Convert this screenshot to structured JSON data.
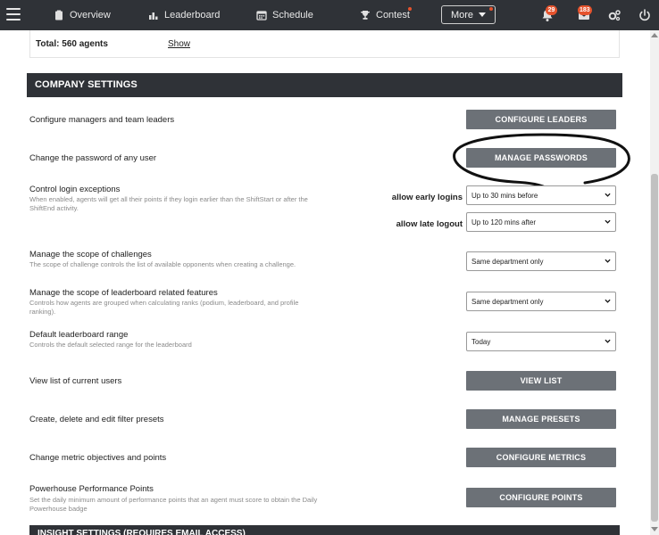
{
  "nav": {
    "items": [
      {
        "label": "Overview",
        "icon": "clipboard-icon"
      },
      {
        "label": "Leaderboard",
        "icon": "bar-chart-icon"
      },
      {
        "label": "Schedule",
        "icon": "calendar-icon"
      },
      {
        "label": "Contest",
        "icon": "trophy-icon"
      }
    ],
    "more_label": "More",
    "notifications_count": "29",
    "messages_count": "183"
  },
  "total": {
    "text": "Total: 560 agents",
    "show_label": "Show"
  },
  "section": {
    "title": "COMPANY SETTINGS",
    "next_title": "INSIGHT SETTINGS (REQUIRES EMAIL ACCESS)"
  },
  "settings": {
    "leaders": {
      "title": "Configure managers and team leaders",
      "button": "CONFIGURE LEADERS"
    },
    "passwords": {
      "title": "Change the password of any user",
      "button": "MANAGE PASSWORDS"
    },
    "login": {
      "title": "Control login exceptions",
      "desc": "When enabled, agents will get all their points if they login earlier than the ShiftStart or after the ShiftEnd activity.",
      "early_label": "allow early logins",
      "early_value": "Up to 30 mins before",
      "late_label": "allow late logout",
      "late_value": "Up to 120 mins after"
    },
    "challenges": {
      "title": "Manage the scope of challenges",
      "desc": "The scope of challenge controls the list of available opponents when creating a challenge.",
      "value": "Same department only"
    },
    "leaderboard_scope": {
      "title": "Manage the scope of leaderboard related features",
      "desc": "Controls how agents are grouped when calculating ranks (podium, leaderboard, and profile ranking).",
      "value": "Same department only"
    },
    "leaderboard_range": {
      "title": "Default leaderboard range",
      "desc": "Controls the default selected range for the leaderboard",
      "value": "Today"
    },
    "users": {
      "title": "View list of current users",
      "button": "VIEW LIST"
    },
    "presets": {
      "title": "Create, delete and edit filter presets",
      "button": "MANAGE PRESETS"
    },
    "metrics": {
      "title": "Change metric objectives and points",
      "button": "CONFIGURE METRICS"
    },
    "powerhouse": {
      "title": "Powerhouse Performance Points",
      "desc": "Set the daily minimum amount of performance points that an agent must score to obtain the Daily Powerhouse badge",
      "button": "CONFIGURE POINTS"
    }
  },
  "colors": {
    "nav_bg": "#2f3237",
    "button_bg": "#6c7177",
    "badge": "#e5532d"
  }
}
